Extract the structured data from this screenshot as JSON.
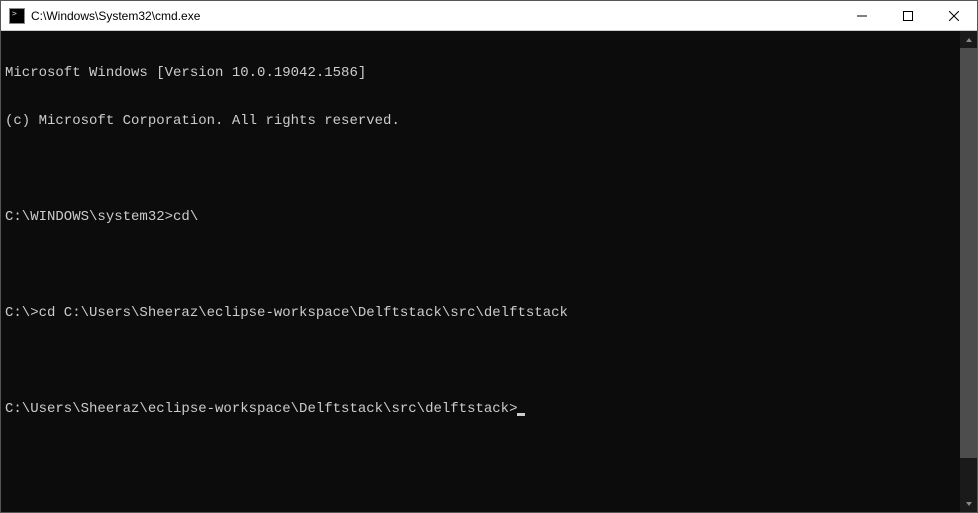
{
  "window": {
    "title": "C:\\Windows\\System32\\cmd.exe"
  },
  "terminal": {
    "lines": [
      "Microsoft Windows [Version 10.0.19042.1586]",
      "(c) Microsoft Corporation. All rights reserved.",
      "",
      "C:\\WINDOWS\\system32>cd\\",
      "",
      "C:\\>cd C:\\Users\\Sheeraz\\eclipse-workspace\\Delftstack\\src\\delftstack",
      "",
      "C:\\Users\\Sheeraz\\eclipse-workspace\\Delftstack\\src\\delftstack>"
    ]
  }
}
